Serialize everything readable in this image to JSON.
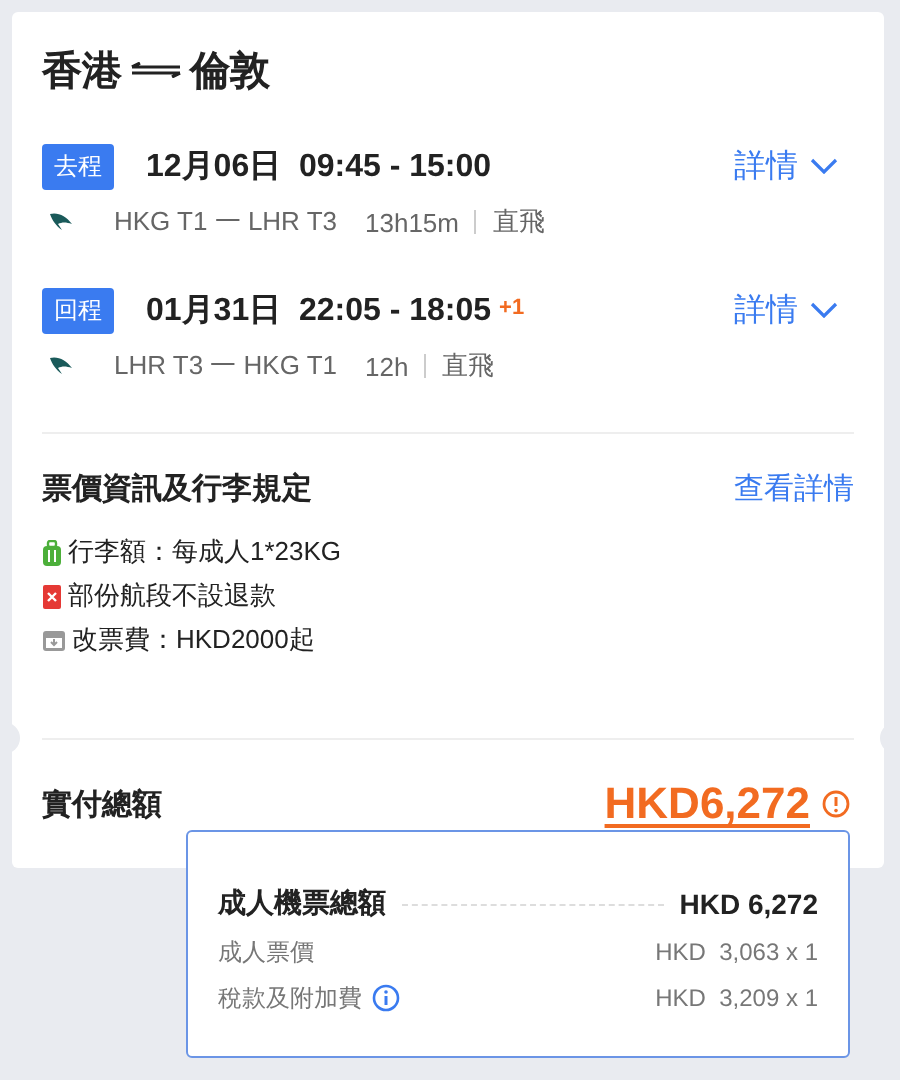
{
  "route": {
    "from": "香港",
    "to": "倫敦"
  },
  "legs": [
    {
      "tag": "去程",
      "date_time": "12月06日  09:45 - 15:00",
      "path": "HKG T1 一 LHR T3",
      "duration": "13h15m",
      "type": "直飛",
      "details": "詳情"
    },
    {
      "tag": "回程",
      "date_time": "01月31日  22:05 - 18:05",
      "day_offset": "+1",
      "path": "LHR T3 一 HKG T1",
      "duration": "12h",
      "type": "直飛",
      "details": "詳情"
    }
  ],
  "fare": {
    "heading": "票價資訊及行李規定",
    "link": "查看詳情",
    "rules": [
      {
        "kind": "baggage",
        "text": "行李額：每成人1*23KG"
      },
      {
        "kind": "refund",
        "text": "部份航段不設退款"
      },
      {
        "kind": "change",
        "text": "改票費：HKD2000起"
      }
    ]
  },
  "total": {
    "label": "實付總額",
    "amount": "HKD6,272"
  },
  "breakdown": {
    "label": "成人機票總額",
    "amount": "HKD  6,272",
    "rows": [
      {
        "label": "成人票價",
        "value": "HKD  3,063 x 1",
        "info": false
      },
      {
        "label": "稅款及附加費",
        "value": "HKD  3,209 x 1",
        "info": true
      }
    ]
  }
}
